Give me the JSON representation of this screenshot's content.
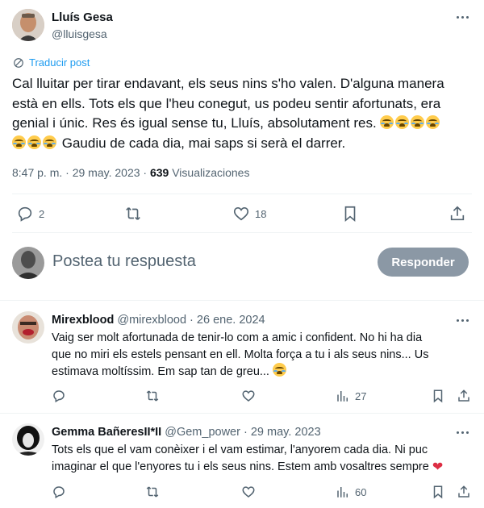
{
  "post": {
    "author_name": "Lluís Gesa",
    "author_handle": "@lluisgesa",
    "translate_label": "Traducir post",
    "text_line1": "Cal lluitar per tirar endavant, els seus nins s'ho valen. D'alguna manera",
    "text_line2": "està en ells. Tots els que l'heu conegut, us podeu sentir afortunats, era",
    "text_line3": "genial i únic. Res és igual sense tu, Lluís, absolutament res.",
    "text_line4": "Gaudiu de cada dia, mai saps si serà el darrer.",
    "time": "8:47 p. m.",
    "date": "29 may. 2023",
    "views_count": "639",
    "views_label": "Visualizaciones",
    "replies": "2",
    "likes": "18"
  },
  "composer": {
    "placeholder": "Postea tu respuesta",
    "reply_button": "Responder"
  },
  "replies": [
    {
      "name": "Mirexblood",
      "handle": "@mirexblood",
      "date": "26 ene. 2024",
      "line1": "Vaig ser molt afortunada de tenir-lo com a amic i confident. No hi ha dia",
      "line2": "que no miri els estels pensant en ell. Molta força a tu i als seus nins... Us",
      "line3": "estimava moltíssim. Em sap tan de greu...",
      "views": "27"
    },
    {
      "name": "Gemma BañeresII*II",
      "handle": "@Gem_power",
      "date": "29 may. 2023",
      "line1": "Tots els que el vam conèixer i el vam estimar, l'anyorem cada dia. Ni puc",
      "line2": "imaginar el que l'enyores tu i els seus nins. Estem amb vosaltres sempre",
      "views": "60"
    }
  ],
  "separators": {
    "dot": "·"
  },
  "colors": {
    "link": "#1d9bf0",
    "muted": "#536471",
    "reply_button_bg": "#8b98a5",
    "heart": "#dd2e44"
  }
}
